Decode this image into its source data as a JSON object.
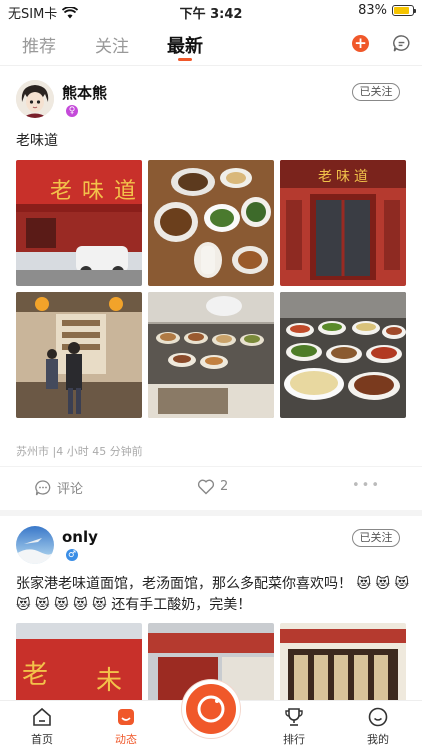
{
  "status": {
    "carrier": "无SIM卡",
    "time": "下午 3:42",
    "battery_pct": "83%",
    "battery_level": 0.83
  },
  "topnav": {
    "tabs": [
      {
        "label": "推荐"
      },
      {
        "label": "关注"
      },
      {
        "label": "最新"
      }
    ],
    "active_tab": "最新",
    "accent": "#f0582a"
  },
  "posts": [
    {
      "username": "熊本熊",
      "follow_label": "已关注",
      "text": "老味道",
      "location_time": "苏州市 |4 小时 45 分钟前",
      "comment_label": "评论",
      "like_count": "2",
      "photos": [
        {
          "sign": "老味道"
        },
        {
          "sign": ""
        },
        {
          "sign": "老味道"
        },
        {
          "sign": ""
        },
        {
          "sign": ""
        },
        {
          "sign": ""
        }
      ]
    },
    {
      "username": "only",
      "follow_label": "已关注",
      "text": "张家港老味道面馆，老汤面馆，那么多配菜你喜欢吗！ 😻 😻 😻 😻 😻 😻 😻 😻 还有手工酸奶，完美！"
    }
  ],
  "tabbar": {
    "items": [
      {
        "label": "首页"
      },
      {
        "label": "动态"
      },
      {
        "label": "排行"
      },
      {
        "label": "我的"
      }
    ]
  }
}
